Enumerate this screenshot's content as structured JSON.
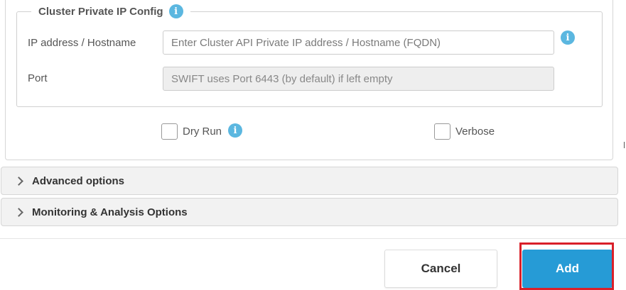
{
  "cluster_private_ip": {
    "legend": "Cluster Private IP Config",
    "legend_icon": "info-icon",
    "ip_label": "IP address / Hostname",
    "ip_placeholder": "Enter Cluster API Private IP address / Hostname (FQDN)",
    "ip_value": "",
    "ip_icon": "info-icon",
    "port_label": "Port",
    "port_placeholder": "SWIFT uses Port 6443 (by default) if left empty",
    "port_value": ""
  },
  "options": {
    "dry_run_label": "Dry Run",
    "dry_run_checked": false,
    "dry_run_icon": "info-icon",
    "verbose_label": "Verbose",
    "verbose_checked": false
  },
  "accordions": [
    {
      "label": "Advanced options",
      "icon": "chevron-right-icon"
    },
    {
      "label": "Monitoring & Analysis Options",
      "icon": "chevron-right-icon"
    }
  ],
  "footer": {
    "cancel_label": "Cancel",
    "add_label": "Add"
  },
  "colors": {
    "accent": "#269bd6",
    "info_icon": "#5bb7e0",
    "highlight": "#d9202a",
    "panel_bg": "#f2f2f2"
  }
}
